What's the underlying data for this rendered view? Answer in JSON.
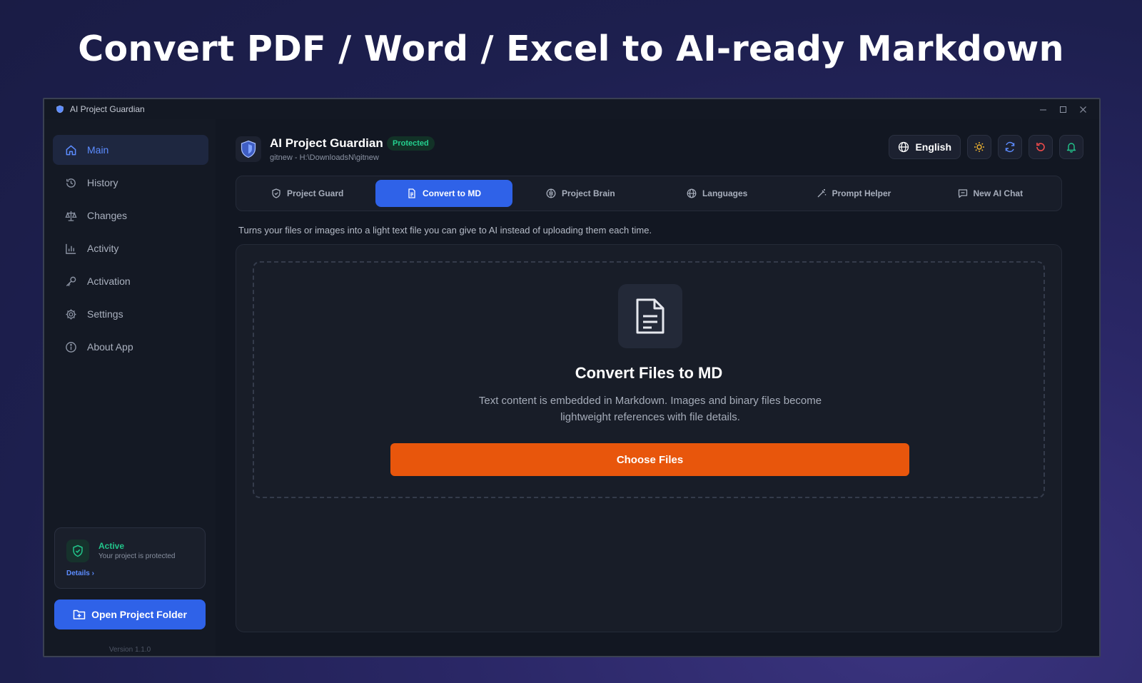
{
  "headline": "Convert PDF / Word / Excel to AI-ready Markdown",
  "window": {
    "title": "AI Project Guardian"
  },
  "sidebar": {
    "items": [
      {
        "label": "Main",
        "icon": "home-icon",
        "active": true
      },
      {
        "label": "History",
        "icon": "history-icon"
      },
      {
        "label": "Changes",
        "icon": "scale-icon"
      },
      {
        "label": "Activity",
        "icon": "bar-chart-icon"
      },
      {
        "label": "Activation",
        "icon": "key-icon"
      },
      {
        "label": "Settings",
        "icon": "gear-icon"
      },
      {
        "label": "About App",
        "icon": "info-icon"
      }
    ],
    "status": {
      "title": "Active",
      "subtitle": "Your project is protected",
      "link": "Details"
    },
    "open_button": "Open Project Folder",
    "version": "Version 1.1.0"
  },
  "header": {
    "app_name": "AI Project Guardian",
    "badge": "Protected",
    "path": "gitnew - H:\\DownloadsN\\gitnew",
    "language": "English"
  },
  "tabs": [
    {
      "label": "Project Guard",
      "icon": "shield-icon"
    },
    {
      "label": "Convert to MD",
      "icon": "document-icon",
      "active": true
    },
    {
      "label": "Project Brain",
      "icon": "brain-icon"
    },
    {
      "label": "Languages",
      "icon": "globe-icon"
    },
    {
      "label": "Prompt Helper",
      "icon": "magic-wand-icon"
    },
    {
      "label": "New AI Chat",
      "icon": "chat-icon"
    }
  ],
  "description": "Turns your files or images into a light text file you can give to AI instead of uploading them each time.",
  "dropzone": {
    "title": "Convert Files to MD",
    "description": "Text content is embedded in Markdown. Images and binary files become lightweight references with file details.",
    "button": "Choose Files"
  },
  "colors": {
    "accent": "#2f62e8",
    "cta": "#e8560c",
    "success": "#22c58b",
    "warning_icon": "#f2b531",
    "danger_icon": "#ef4b4b"
  }
}
